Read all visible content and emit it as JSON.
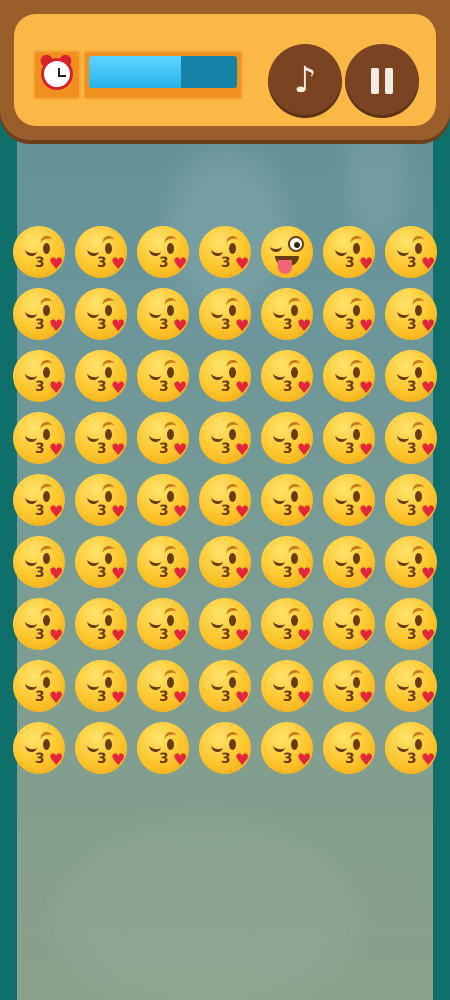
{
  "hud": {
    "timer_icon": "alarm-clock-icon",
    "timer_progress": 0.62,
    "music_icon": "music-note-icon",
    "music_label": "♪",
    "pause_icon": "pause-icon"
  },
  "board": {
    "columns": 7,
    "rows": 9,
    "tile_emoji": "kissing-winking-face-with-heart",
    "odd_one_out": {
      "row": 0,
      "column": 4,
      "emoji": "winking-face-with-tongue"
    }
  },
  "colors": {
    "hud_frame": "#9a5e2b",
    "hud_panel": "#fbb847",
    "timer_fill": "#26b3e8",
    "button": "#7a4422",
    "side_bg": "#0f6f6a"
  }
}
